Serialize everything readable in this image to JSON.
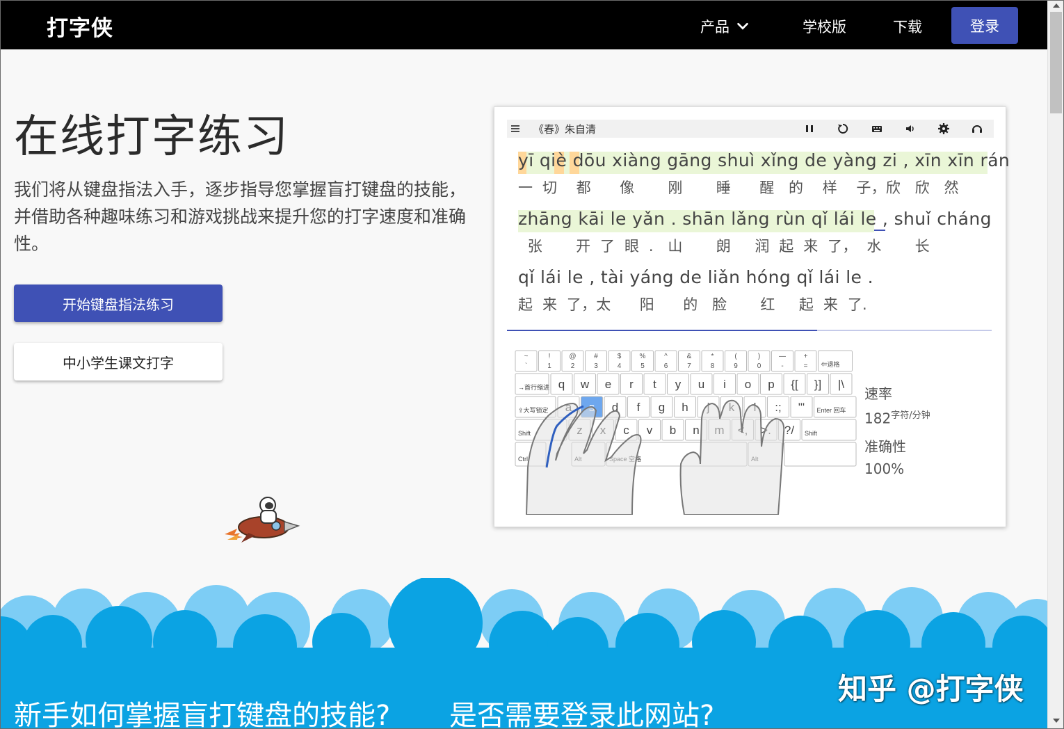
{
  "nav": {
    "brand": "打字侠",
    "products": "产品",
    "school": "学校版",
    "download": "下载",
    "login": "登录"
  },
  "hero": {
    "title": "在线打字练习",
    "description": "我们将从键盘指法入手，逐步指导您掌握盲打键盘的技能，并借助各种趣味练习和游戏挑战来提升您的打字速度和准确性。",
    "primary_button": "开始键盘指法练习",
    "secondary_button": "中小学生课文打字"
  },
  "demo": {
    "title": "《春》朱自清",
    "lines": [
      {
        "pinyin": "yī qiè dōu xiàng gāng shuì xǐng de yàng zi , xīn xīn rán",
        "hanzi": "一  切    都      像       刚       睡      醒   的    样    子，欣   欣   然"
      },
      {
        "pinyin": "zhāng kāi le yǎn . shān lǎng rùn qǐ lái le , shuǐ cháng",
        "hanzi": "  张       开  了  眼  .   山       朗     润  起  来  了，  水       长"
      },
      {
        "pinyin": "qǐ lái le , tài yáng de liǎn hóng qǐ lái le .",
        "hanzi": "起  来  了，太      阳      的   脸       红     起  来  了."
      }
    ],
    "progress": 0.64,
    "keyboard": {
      "row0": [
        "~`",
        "!1",
        "@2",
        "#3",
        "$4",
        "%5",
        "^6",
        "&7",
        "*8",
        "(9",
        ")0",
        "—-",
        "+="
      ],
      "backspace": "⇐退格",
      "tab": "→首行缩进",
      "row1": [
        "q",
        "w",
        "e",
        "r",
        "t",
        "y",
        "u",
        "i",
        "o",
        "p"
      ],
      "caps": "⇪大写锁定",
      "row2": [
        "a",
        "s",
        "d",
        "f",
        "g",
        "h",
        "j",
        "k",
        "l"
      ],
      "enter": "Enter 回车",
      "shift": "Shift",
      "row3": [
        "z",
        "x",
        "c",
        "v",
        "b",
        "n",
        "m"
      ],
      "ctrl": "Ctrl",
      "alt": "Alt",
      "space": "Space 空格",
      "highlight_key": "s"
    },
    "stats": {
      "speed_label": "速率",
      "speed_value": "182",
      "speed_unit": "字符/分钟",
      "accuracy_label": "准确性",
      "accuracy_value": "100%"
    }
  },
  "faq": {
    "q1": "新手如何掌握盲打键盘的技能?",
    "q2": "是否需要登录此网站?"
  },
  "watermark": "知乎 @打字侠",
  "colors": {
    "accent": "#3f51b5",
    "nav_bg": "#000000",
    "cloud_dark": "#0ba3e3",
    "cloud_light": "#7dcdf5"
  }
}
